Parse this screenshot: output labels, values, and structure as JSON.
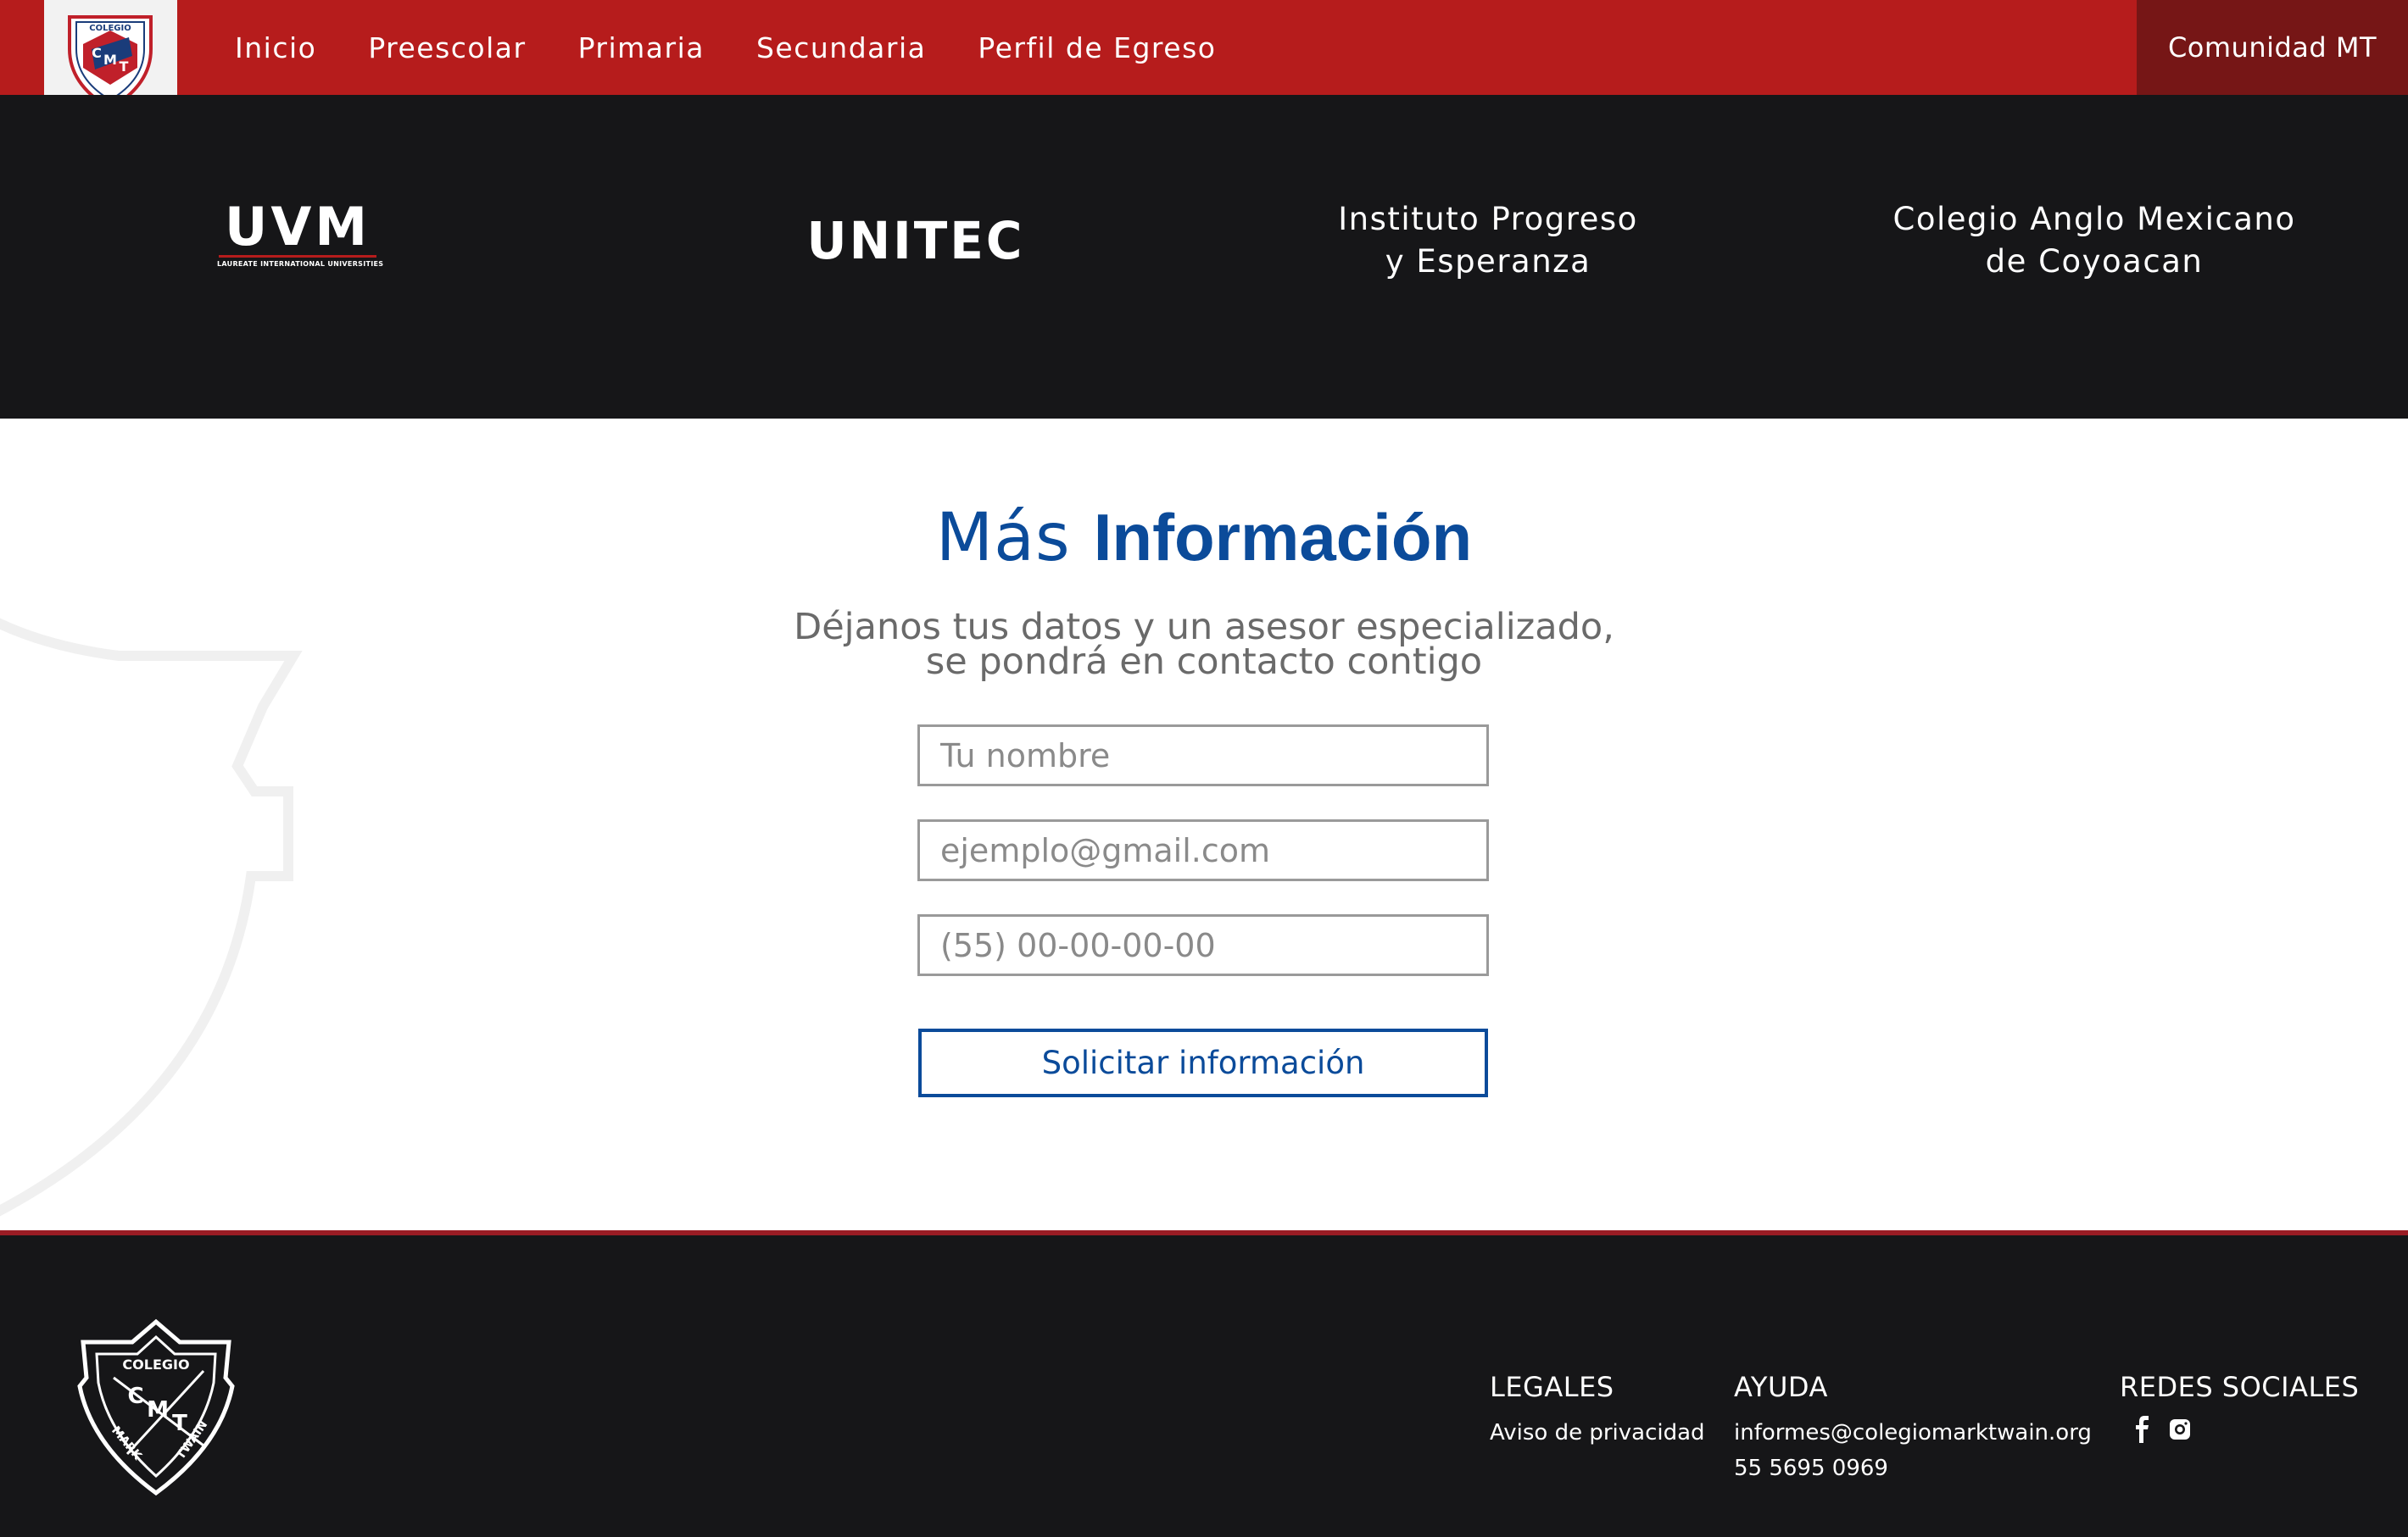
{
  "nav": {
    "items": [
      {
        "label": "Inicio"
      },
      {
        "label": "Preescolar"
      },
      {
        "label": "Primaria"
      },
      {
        "label": "Secundaria"
      },
      {
        "label": "Perfil de Egreso"
      }
    ],
    "community": "Comunidad MT"
  },
  "logo": {
    "top": "COLEGIO",
    "monogram_c": "C",
    "monogram_m": "M",
    "monogram_t": "T",
    "bottom_left": "MARK",
    "bottom_right": "TWAIN"
  },
  "partners": {
    "uvm": {
      "word": "UVM",
      "sub": "LAUREATE INTERNATIONAL UNIVERSITIES"
    },
    "unitec": "UNITEC",
    "ipe": {
      "line1": "Instituto Progreso",
      "line2": "y Esperanza"
    },
    "cam": {
      "line1": "Colegio Anglo Mexicano",
      "line2": "de Coyoacan"
    }
  },
  "form": {
    "title_light": "Más",
    "title_bold": "Información",
    "subtitle_line1": "Déjanos tus datos y un asesor especializado,",
    "subtitle_line2": "se pondrá en contacto contigo",
    "name_placeholder": "Tu nombre",
    "email_placeholder": "ejemplo@gmail.com",
    "phone_placeholder": "(55) 00-00-00-00",
    "submit_label": "Solicitar información"
  },
  "footer": {
    "legal_title": "LEGALES",
    "privacy_link": "Aviso de privacidad",
    "help_title": "AYUDA",
    "email": "informes@colegiomarktwain.org",
    "phone": "55 5695 0969",
    "social_title": "REDES SOCIALES",
    "social": [
      "facebook-icon",
      "instagram-icon"
    ]
  },
  "colors": {
    "nav_red": "#b61c1c",
    "nav_dark_red": "#761616",
    "dark_band": "#161618",
    "brand_blue": "#0b4b9a",
    "footer_rule": "#9a1c24"
  }
}
